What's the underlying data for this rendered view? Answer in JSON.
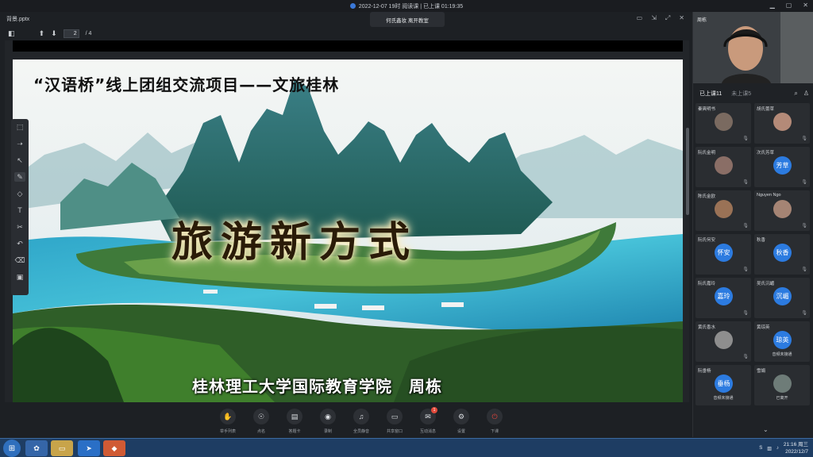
{
  "window": {
    "title": "2022-12-07 19时 阅读课 | 已上课 01:19:35",
    "controls": [
      "▁",
      "▢",
      "✕"
    ]
  },
  "toast": "何氏鑫妆 离开教室",
  "document": {
    "filename": "背景.pptx",
    "controls": [
      "▭",
      "⇲",
      "⤢",
      "✕"
    ],
    "page_current": "2",
    "page_total": "/ 4"
  },
  "slide": {
    "title": "“汉语桥”线上团组交流项目——文旅桂林",
    "headline": "旅游新方式",
    "footer": "桂林理工大学国际教育学院　周栋"
  },
  "annotation_tools": [
    {
      "name": "laser-tool",
      "glyph": "⬚"
    },
    {
      "name": "pointer-arrow-tool",
      "glyph": "➝"
    },
    {
      "name": "select-tool",
      "glyph": "↖"
    },
    {
      "name": "pen-tool",
      "glyph": "✎"
    },
    {
      "name": "shapes-tool",
      "glyph": "◇"
    },
    {
      "name": "text-tool",
      "glyph": "T"
    },
    {
      "name": "scissors-tool",
      "glyph": "✂"
    },
    {
      "name": "undo-tool",
      "glyph": "↶"
    },
    {
      "name": "eraser-tool",
      "glyph": "⌫"
    },
    {
      "name": "toolbox-tool",
      "glyph": "▣"
    }
  ],
  "controls": [
    {
      "name": "hand-raise",
      "glyph": "✋",
      "label": "举手列表"
    },
    {
      "name": "roll-call",
      "glyph": "☉",
      "label": "点名"
    },
    {
      "name": "answer-card",
      "glyph": "▤",
      "label": "答题卡"
    },
    {
      "name": "record",
      "glyph": "◉",
      "label": "录制"
    },
    {
      "name": "all-mute",
      "glyph": "♫",
      "label": "全员静音"
    },
    {
      "name": "share-window",
      "glyph": "▭",
      "label": "共享窗口"
    },
    {
      "name": "interactive-messages",
      "glyph": "✉",
      "label": "互动消息",
      "badge": "1"
    },
    {
      "name": "settings",
      "glyph": "⚙",
      "label": "设置"
    },
    {
      "name": "end-class",
      "glyph": "⏻",
      "label": "下课"
    }
  ],
  "panel": {
    "teacher_name": "周栋",
    "tab_attended": "已上课11",
    "tab_absent": "未上课5",
    "students": [
      {
        "name": "秦爽明书",
        "avatar": "photo"
      },
      {
        "name": "胡氏蕾草",
        "avatar": "photo"
      },
      {
        "name": "阮氏金明",
        "avatar": "photo"
      },
      {
        "name": "次氏芳草",
        "avatar": "芳草"
      },
      {
        "name": "陈氏金欧",
        "avatar": "photo"
      },
      {
        "name": "Nguyen Ngo",
        "avatar": "photo"
      },
      {
        "name": "阮氏何安",
        "avatar": "怀安"
      },
      {
        "name": "秋香",
        "avatar": "秋香"
      },
      {
        "name": "阮氏嘉玲",
        "avatar": "嘉玲"
      },
      {
        "name": "吴氏沉嵋",
        "avatar": "沉嵋"
      },
      {
        "name": "黄氏香水",
        "avatar": "photo"
      },
      {
        "name": "黄琼英",
        "avatar": "琼英",
        "sub": "音频未接通"
      },
      {
        "name": "阮垂杨",
        "avatar": "垂杨",
        "sub": "音频未接通"
      },
      {
        "name": "雪娟",
        "avatar": "photo",
        "sub": "已离开"
      }
    ]
  },
  "taskbar": {
    "time": "21:16 周三",
    "date": "2022/12/7"
  }
}
